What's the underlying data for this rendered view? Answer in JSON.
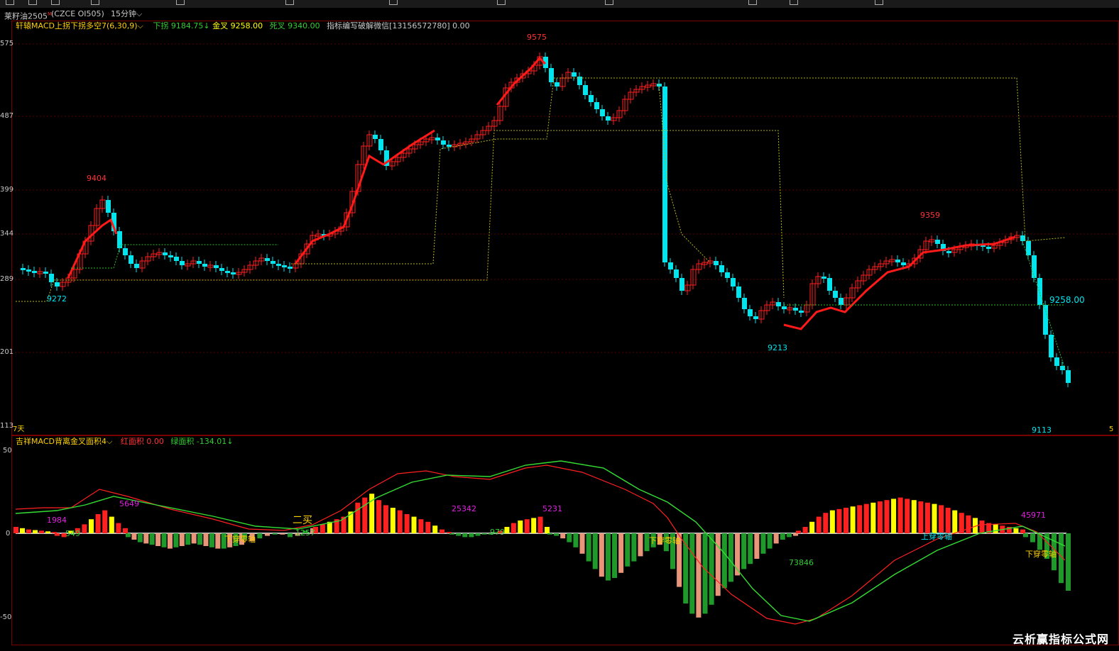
{
  "header": {
    "symbol_name": "莱籽油2505",
    "symbol_sup": "M",
    "symbol_code": "(CZCE OI505)",
    "period": "15分钟"
  },
  "main_panel": {
    "indicator_name": "轩辕MACD上拐下拐多空7(6,30,9)",
    "items": [
      {
        "label": "下拐",
        "value": "9184.75",
        "arrow": "↓",
        "color": "#33cc33"
      },
      {
        "label": "金叉",
        "value": "9258.00",
        "color": "#ffff00"
      },
      {
        "label": "死叉",
        "value": "9340.00",
        "color": "#33cc33"
      }
    ],
    "note": "指标编写破解微信[13156572780] 0.00",
    "price_labels": {
      "p9575": "9575",
      "p9404": "9404",
      "p9359": "9359",
      "p9272": "9272",
      "p9213": "9213",
      "p9113": "9113",
      "p9258": "9258.00"
    },
    "axis_ticks": [
      "575",
      "487",
      "399",
      "344",
      "289",
      "201",
      "113"
    ],
    "bottom_left": "7天",
    "bottom_right": "5"
  },
  "sub_panel": {
    "indicator_name": "吉祥MACD背离金叉面积4",
    "red_area": {
      "label": "红面积",
      "value": "0.00"
    },
    "green_area": {
      "label": "绿面积",
      "value": "-134.01",
      "arrow": "↓"
    },
    "axis_ticks": [
      "50",
      "0",
      "-50"
    ],
    "area_labels": {
      "a1984": "1984",
      "a549": "549",
      "a5649": "5649",
      "a1257": "1257",
      "a25342": "25342",
      "a979": "979",
      "a5231": "5231",
      "a73846": "73846",
      "a45971": "45971"
    },
    "signals": {
      "cross_down": "下穿零轴",
      "cross_up": "上穿零轴",
      "buy2": "二买"
    }
  },
  "watermark": "云析赢指标公式网",
  "colors": {
    "up": "#ff2020",
    "down": "#00e5ee",
    "yellow": "#ffff00",
    "green": "#1f9a2a",
    "salmon": "#e8957a",
    "magenta": "#e020e0"
  }
}
